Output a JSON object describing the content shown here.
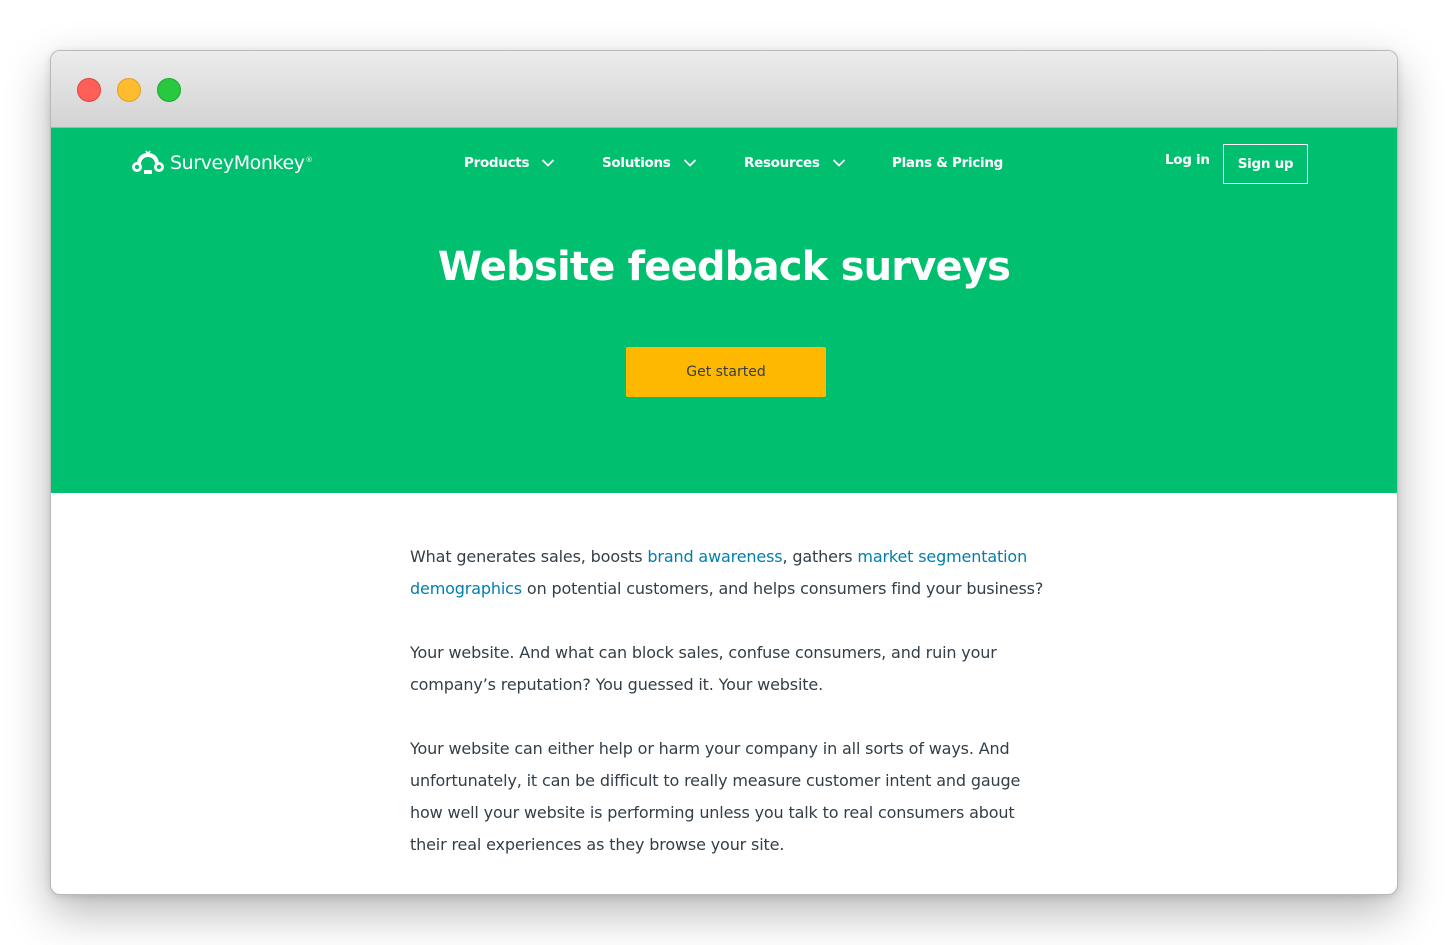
{
  "brand": {
    "name": "SurveyMonkey",
    "trademark": "®",
    "primary_color": "#00bf6f",
    "cta_color": "#ffb800",
    "link_color": "#007faa",
    "text_color": "#333e48"
  },
  "nav": {
    "items": [
      {
        "label": "Products",
        "icon": "chevron-down-icon"
      },
      {
        "label": "Solutions",
        "icon": "chevron-down-icon"
      },
      {
        "label": "Resources",
        "icon": "chevron-down-icon"
      },
      {
        "label": "Plans & Pricing"
      }
    ],
    "login_label": "Log in",
    "signup_label": "Sign up"
  },
  "hero": {
    "title": "Website feedback surveys",
    "cta_label": "Get started"
  },
  "content": {
    "p1": {
      "t1": "What generates sales, boosts ",
      "link1": "brand awareness",
      "t2": ", gathers ",
      "link2": "market segmentation demographics",
      "t3": " on potential customers, and helps consumers find your business?"
    },
    "p2": "Your website. And what can block sales, confuse consumers, and ruin your company’s reputation? You guessed it. Your website.",
    "p3": "Your website can either help or harm your company in all sorts of ways. And unfortunately, it can be difficult to really measure customer intent and gauge how well your website is performing unless you talk to real consumers about their real experiences as they browse your site."
  }
}
